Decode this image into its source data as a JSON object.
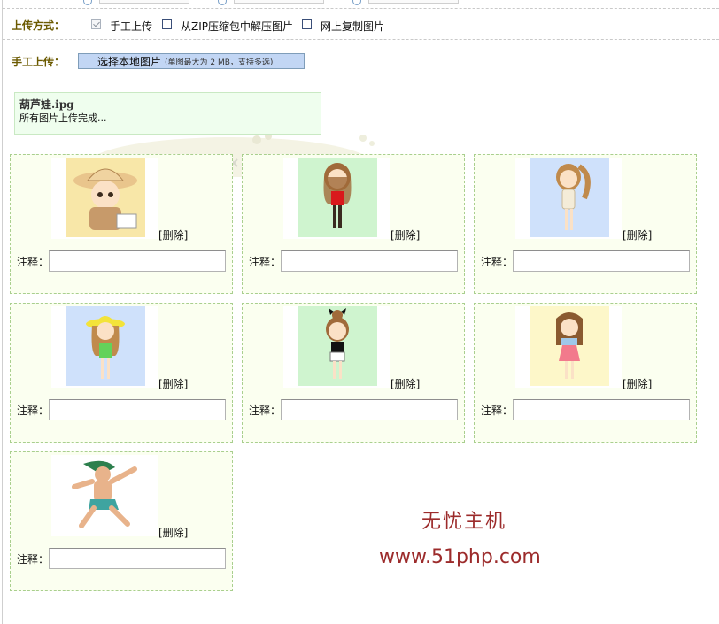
{
  "upload_mode": {
    "label": "上传方式：",
    "options": [
      {
        "label": "手工上传",
        "checked": true
      },
      {
        "label": "从ZIP压缩包中解压图片",
        "checked": false
      },
      {
        "label": "网上复制图片",
        "checked": false
      }
    ]
  },
  "manual_upload": {
    "label": "手工上传：",
    "button_label": "选择本地图片",
    "button_hint": "(单图最大为 2 MB，支持多选)"
  },
  "status": {
    "filename": "葫芦娃.ipg",
    "message": "所有图片上传完成..."
  },
  "images": [
    {
      "delete_label": "[删除]",
      "note_label": "注释：",
      "note_value": "",
      "icon": "boy-straw-hat-image",
      "bg": "#f8e7a8"
    },
    {
      "delete_label": "[删除]",
      "note_label": "注释：",
      "note_value": "",
      "icon": "girl-red-top-image",
      "bg": "#cff4cf"
    },
    {
      "delete_label": "[删除]",
      "note_label": "注释：",
      "note_value": "",
      "icon": "girl-ponytail-image",
      "bg": "#cfe1fb"
    },
    {
      "delete_label": "[删除]",
      "note_label": "注释：",
      "note_value": "",
      "icon": "girl-yellow-hat-image",
      "bg": "#cfe1fb"
    },
    {
      "delete_label": "[删除]",
      "note_label": "注释：",
      "note_value": "",
      "icon": "girl-bun-image",
      "bg": "#cff4cf"
    },
    {
      "delete_label": "[删除]",
      "note_label": "注释：",
      "note_value": "",
      "icon": "girl-pink-dress-image",
      "bg": "#fdf7c9"
    },
    {
      "delete_label": "[删除]",
      "note_label": "注释：",
      "note_value": "",
      "icon": "calabash-brother-image",
      "bg": "#ffffff"
    }
  ],
  "watermark": {
    "line1": "无忧主机",
    "line2": "www.51php.com"
  },
  "colors": {
    "card_bg": "#fbfff0",
    "card_border": "#a9cf8e",
    "status_bg": "#effeee",
    "button_bg": "#c2d6f4",
    "label_color": "#6b5a00",
    "watermark": "#9c2b2b"
  }
}
